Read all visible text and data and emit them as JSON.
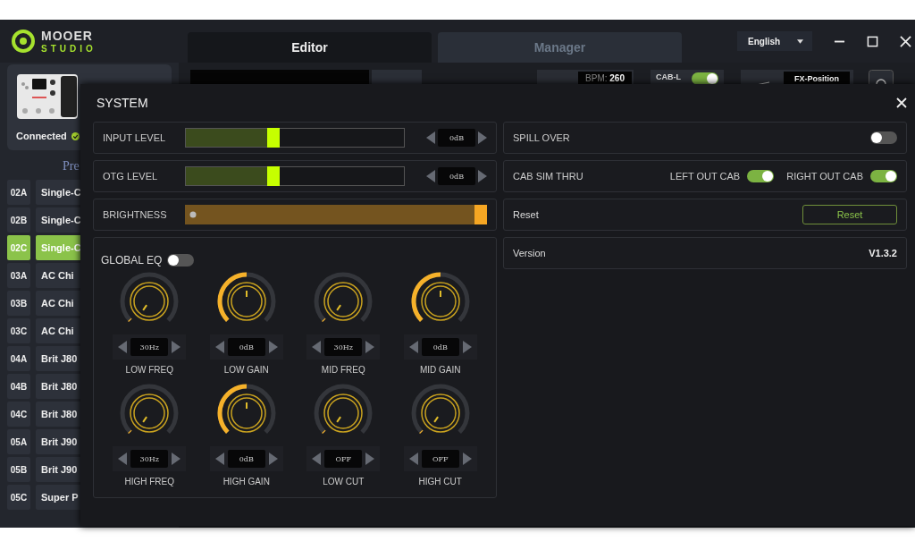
{
  "logo": {
    "brand": "MOOER",
    "product": "STUDIO"
  },
  "tabs": [
    {
      "label": "Editor",
      "selected": true
    },
    {
      "label": "Manager",
      "selected": false
    }
  ],
  "language": "English",
  "device": {
    "status": "Connected",
    "connected": true
  },
  "presets_heading": "Pre",
  "presets": [
    {
      "code": "02A",
      "name": "Single-C",
      "selected": false
    },
    {
      "code": "02B",
      "name": "Single-C",
      "selected": false
    },
    {
      "code": "02C",
      "name": "Single-C",
      "selected": true
    },
    {
      "code": "03A",
      "name": "AC Chi",
      "selected": false
    },
    {
      "code": "03B",
      "name": "AC Chi",
      "selected": false
    },
    {
      "code": "03C",
      "name": "AC Chi",
      "selected": false
    },
    {
      "code": "04A",
      "name": "Brit J80",
      "selected": false
    },
    {
      "code": "04B",
      "name": "Brit J80",
      "selected": false
    },
    {
      "code": "04C",
      "name": "Brit J80",
      "selected": false
    },
    {
      "code": "05A",
      "name": "Brit J90",
      "selected": false
    },
    {
      "code": "05B",
      "name": "Brit J90",
      "selected": false
    },
    {
      "code": "05C",
      "name": "Super P",
      "selected": false
    }
  ],
  "editor": {
    "bpm_label": "BPM:",
    "bpm": "260",
    "cab_label": "CAB-L",
    "cab_on": true,
    "fx_position": "FX-Position"
  },
  "system": {
    "title": "SYSTEM",
    "levels": [
      {
        "kind": "level",
        "label": "INPUT LEVEL",
        "level": 0.4,
        "value": "0dB"
      },
      {
        "kind": "level",
        "label": "OTG LEVEL",
        "level": 0.4,
        "value": "0dB"
      },
      {
        "kind": "brightness",
        "label": "BRIGHTNESS",
        "level": 1.0
      }
    ],
    "global_eq": {
      "label": "GLOBAL EQ",
      "on": false
    },
    "knobs": [
      {
        "label": "LOW FREQ",
        "value": "30Hz",
        "level": 0
      },
      {
        "label": "LOW GAIN",
        "value": "0dB",
        "level": 0.5
      },
      {
        "label": "MID FREQ",
        "value": "30Hz",
        "level": 0
      },
      {
        "label": "MID GAIN",
        "value": "0dB",
        "level": 0.5
      },
      {
        "label": "HIGH FREQ",
        "value": "30Hz",
        "level": 0
      },
      {
        "label": "HIGH GAIN",
        "value": "0dB",
        "level": 0.5
      },
      {
        "label": "LOW CUT",
        "value": "OFF",
        "level": 0
      },
      {
        "label": "HIGH CUT",
        "value": "OFF",
        "level": 0
      }
    ],
    "spill_over": {
      "label": "SPILL OVER",
      "on": false
    },
    "cab_sim_thru": {
      "label": "CAB SIM THRU",
      "left_label": "LEFT OUT CAB",
      "left_on": true,
      "right_label": "RIGHT OUT CAB",
      "right_on": true
    },
    "reset": {
      "label": "Reset",
      "button": "Reset"
    },
    "version": {
      "label": "Version",
      "value": "V1.3.2"
    }
  }
}
